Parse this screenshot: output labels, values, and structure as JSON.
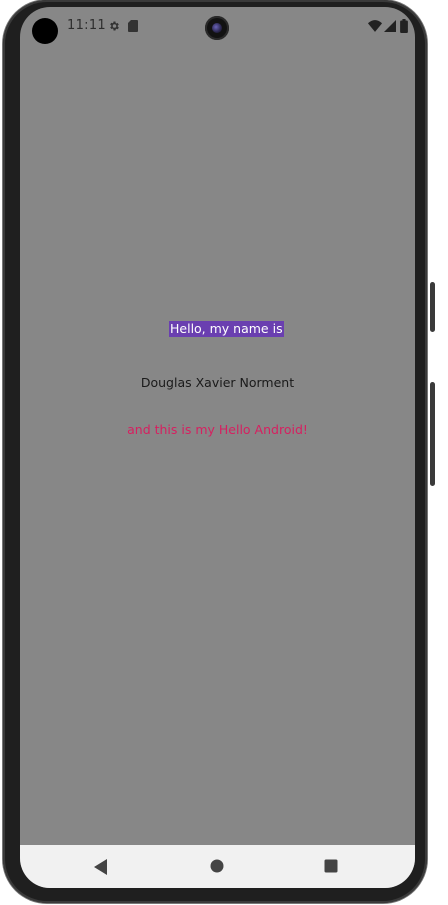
{
  "status_bar": {
    "time": "11:11",
    "icons": [
      "gear-icon",
      "sd-card-icon",
      "wifi-icon",
      "signal-icon",
      "battery-icon"
    ]
  },
  "content": {
    "greeting": "Hello, my name is",
    "name": "Douglas Xavier Norment",
    "tagline": "and this is my Hello Android!"
  },
  "navigation": {
    "icons": [
      "back-icon",
      "home-icon",
      "recents-icon"
    ]
  },
  "colors": {
    "screen_background": "#878787",
    "greeting_background": "#6a3fb0",
    "greeting_text": "#ffffff",
    "name_text": "#1a1a1a",
    "tagline_text": "#d62060",
    "nav_bar": "#f1f1f1"
  }
}
